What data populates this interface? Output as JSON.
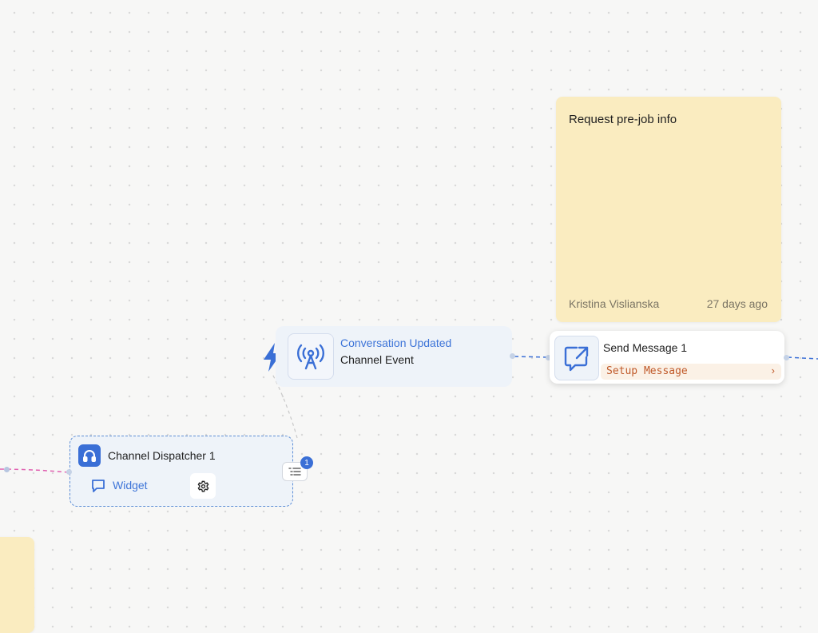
{
  "note_main": {
    "title": "Request pre-job info",
    "author": "Kristina Vislianska",
    "time_ago": "27 days ago"
  },
  "event_node": {
    "subtitle": "Conversation Updated",
    "title": "Channel Event",
    "icon": "broadcast-tower-icon"
  },
  "send_node": {
    "title": "Send Message 1",
    "setup_label": "Setup Message",
    "chevron": "›",
    "icon": "message-send-icon"
  },
  "dispatch_node": {
    "title": "Channel Dispatcher 1",
    "channel_label": "Widget",
    "icon": "headphones-icon"
  },
  "list_button": {
    "badge_count": "1"
  },
  "colors": {
    "accent": "#3a6fd6",
    "note": "#faecc0",
    "edge_pink": "#e060b0",
    "setup_text": "#c05a2a"
  }
}
